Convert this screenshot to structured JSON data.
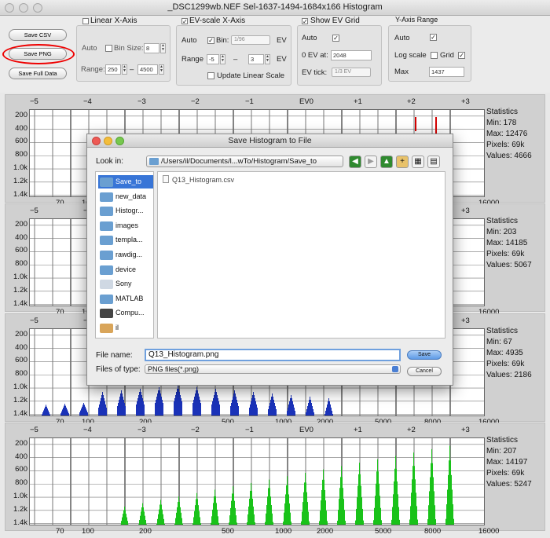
{
  "window": {
    "title": "_DSC1299wb.NEF Sel-1637-1494-1684x166 Histogram"
  },
  "buttons": {
    "save_csv": "Save CSV",
    "save_png": "Save PNG",
    "save_full": "Save Full Data"
  },
  "linear_x": {
    "title": "Linear X-Axis",
    "auto": "Auto",
    "bin_size_label": "Bin Size:",
    "bin_size": "8",
    "range_label": "Range:",
    "range_min": "250",
    "dash": "–",
    "range_max": "4500"
  },
  "ev_x": {
    "title": "EV-scale X-Axis",
    "auto": "Auto",
    "bin_label": "Bin:",
    "bin_value": "1/96",
    "ev_unit": "EV",
    "range_label": "Range",
    "range_min": "-5",
    "dash": "–",
    "range_max": "3",
    "update_label": "Update Linear Scale"
  },
  "ev_grid": {
    "title": "Show EV Grid",
    "auto": "Auto",
    "ev0_label": "0 EV at:",
    "ev0_value": "2048",
    "evtick_label": "EV tick:",
    "evtick_value": "1/3 EV"
  },
  "y_axis": {
    "title": "Y-Axis Range",
    "auto": "Auto",
    "log_label": "Log scale",
    "grid_label": "Grid",
    "max_label": "Max",
    "max_value": "1437"
  },
  "checkmark": "✓",
  "axis": {
    "ev_ticks": [
      "−5",
      "−4",
      "−3",
      "−2",
      "−1",
      "EV0",
      "+1",
      "+2",
      "+3"
    ],
    "y_ticks": [
      "1.4k",
      "1.2k",
      "1.0k",
      "800",
      "600",
      "400",
      "200"
    ],
    "x_ticks": [
      "70",
      "100",
      "200",
      "500",
      "1000",
      "2000",
      "5000",
      "8000",
      "16000"
    ]
  },
  "panels": [
    {
      "color": "#d40000",
      "stats": {
        "title": "Statistics",
        "min": "Min: 178",
        "max": "Max: 12476",
        "pixels": "Pixels: 69k",
        "values": "Values: 4666"
      }
    },
    {
      "color": "#3355cc",
      "stats": {
        "title": "Statistics",
        "min": "Min: 203",
        "max": "Max: 14185",
        "pixels": "Pixels: 69k",
        "values": "Values: 5067"
      }
    },
    {
      "color": "#1a32b8",
      "stats": {
        "title": "Statistics",
        "min": "Min: 67",
        "max": "Max: 4935",
        "pixels": "Pixels: 69k",
        "values": "Values: 2186"
      }
    },
    {
      "color": "#19c219",
      "stats": {
        "title": "Statistics",
        "min": "Min: 207",
        "max": "Max: 14197",
        "pixels": "Pixels: 69k",
        "values": "Values: 5247"
      }
    }
  ],
  "dialog": {
    "title": "Save Histogram to File",
    "look_in_label": "Look in:",
    "path": "/Users/il/Documents/l...wTo/Histogram/Save_to",
    "sidebar": [
      "Save_to",
      "new_data",
      "Histogr...",
      "images",
      "templa...",
      "rawdig...",
      "device",
      "Sony",
      "MATLAB",
      "Compu...",
      "il"
    ],
    "files": [
      "Q13_Histogram.csv"
    ],
    "filename_label": "File name:",
    "filename": "Q13_Histogram.png",
    "filetype_label": "Files of type:",
    "filetype": "PNG files(*.png)",
    "save": "Save",
    "cancel": "Cancel"
  }
}
